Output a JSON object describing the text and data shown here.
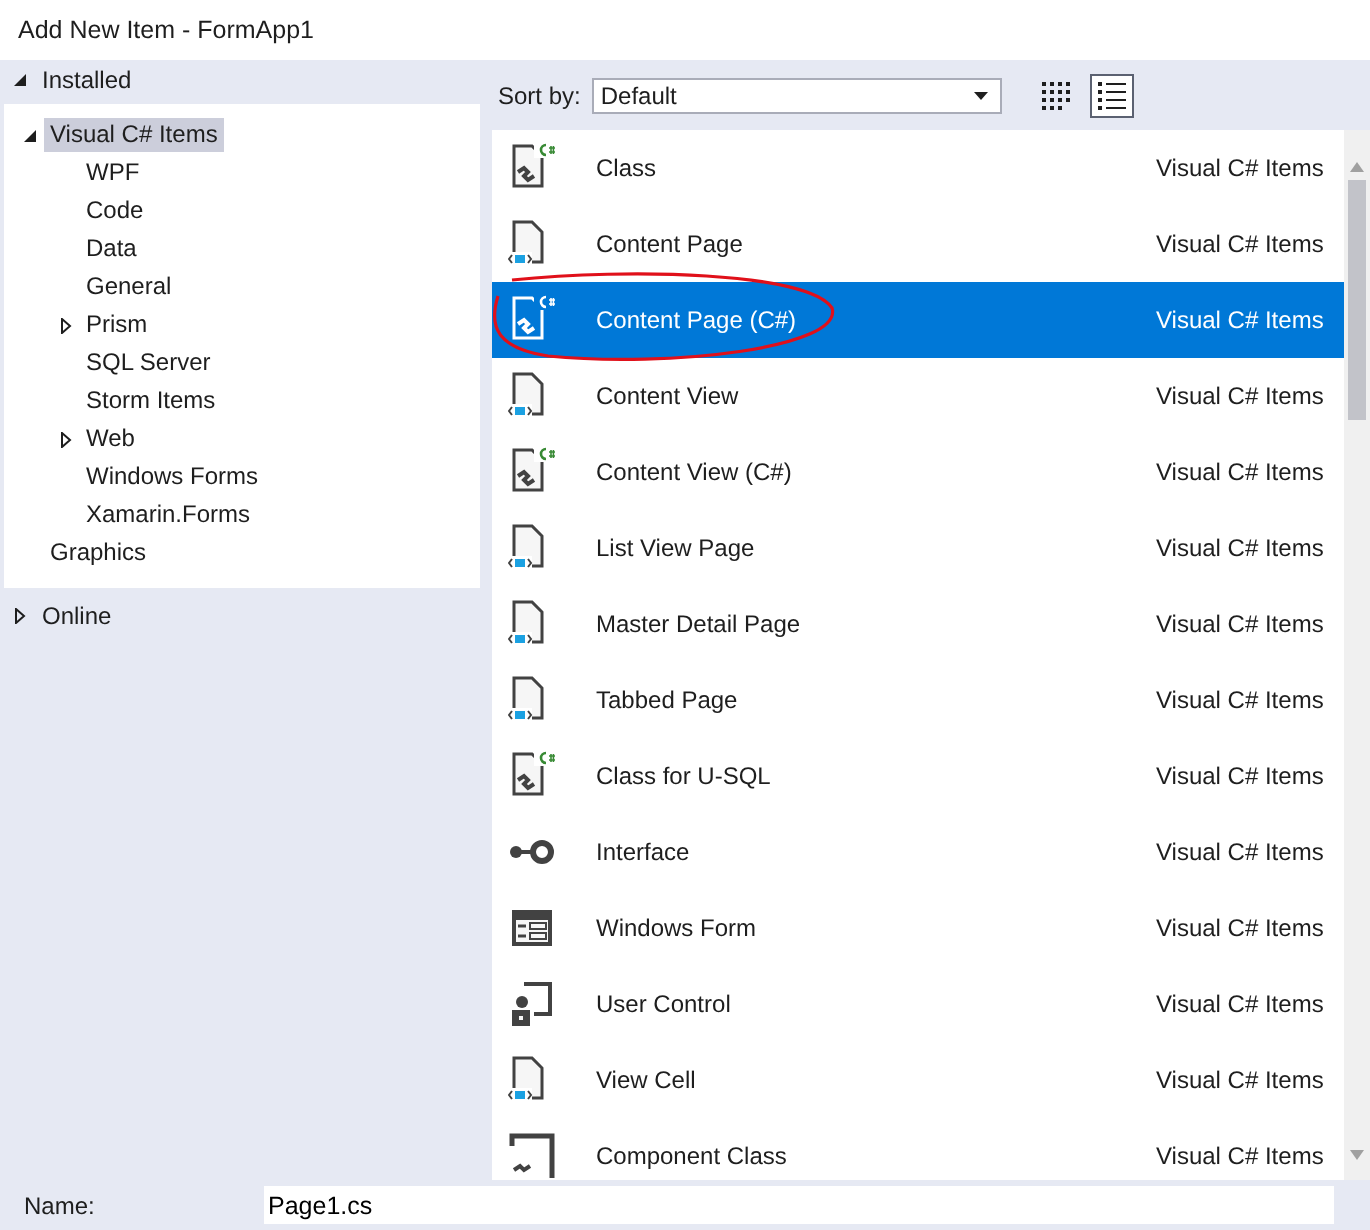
{
  "window": {
    "title": "Add New Item - FormApp1"
  },
  "tree": [
    {
      "label": "Installed",
      "expanded": true,
      "children": [
        {
          "label": "Visual C# Items",
          "expanded": true,
          "selected": true,
          "children": [
            {
              "label": "WPF",
              "selected": false
            },
            {
              "label": "Code",
              "selected": false
            },
            {
              "label": "Data",
              "selected": false
            },
            {
              "label": "General",
              "selected": false
            },
            {
              "label": "Prism",
              "expanded": false,
              "selected": false
            },
            {
              "label": "SQL Server",
              "selected": false
            },
            {
              "label": "Storm Items",
              "selected": false
            },
            {
              "label": "Web",
              "expanded": false,
              "selected": false
            },
            {
              "label": "Windows Forms",
              "selected": false
            },
            {
              "label": "Xamarin.Forms",
              "selected": false
            }
          ]
        },
        {
          "label": "Graphics",
          "selected": false
        }
      ]
    },
    {
      "label": "Online",
      "expanded": false
    }
  ],
  "toolbar": {
    "sort_label": "Sort by:",
    "sort_value": "Default",
    "views": [
      {
        "kind": "grid",
        "selected": false
      },
      {
        "kind": "list",
        "selected": true
      }
    ]
  },
  "items": [
    {
      "name": "Class",
      "category": "Visual C# Items",
      "kind": "cs",
      "selected": false,
      "circled": false
    },
    {
      "name": "Content Page",
      "category": "Visual C# Items",
      "kind": "xaml",
      "selected": false,
      "circled": false
    },
    {
      "name": "Content Page (C#)",
      "category": "Visual C# Items",
      "kind": "cs",
      "selected": true,
      "circled": true
    },
    {
      "name": "Content View",
      "category": "Visual C# Items",
      "kind": "xaml",
      "selected": false,
      "circled": false
    },
    {
      "name": "Content View (C#)",
      "category": "Visual C# Items",
      "kind": "cs",
      "selected": false,
      "circled": false
    },
    {
      "name": "List View Page",
      "category": "Visual C# Items",
      "kind": "xaml",
      "selected": false,
      "circled": false
    },
    {
      "name": "Master Detail Page",
      "category": "Visual C# Items",
      "kind": "xaml",
      "selected": false,
      "circled": false
    },
    {
      "name": "Tabbed Page",
      "category": "Visual C# Items",
      "kind": "xaml",
      "selected": false,
      "circled": false
    },
    {
      "name": "Class for U-SQL",
      "category": "Visual C# Items",
      "kind": "cs",
      "selected": false,
      "circled": false
    },
    {
      "name": "Interface",
      "category": "Visual C# Items",
      "kind": "interface",
      "selected": false,
      "circled": false
    },
    {
      "name": "Windows Form",
      "category": "Visual C# Items",
      "kind": "form",
      "selected": false,
      "circled": false
    },
    {
      "name": "User Control",
      "category": "Visual C# Items",
      "kind": "usercontrol",
      "selected": false,
      "circled": false
    },
    {
      "name": "View Cell",
      "category": "Visual C# Items",
      "kind": "xaml",
      "selected": false,
      "circled": false
    },
    {
      "name": "Component Class",
      "category": "Visual C# Items",
      "kind": "component",
      "selected": false,
      "circled": false
    }
  ],
  "name_field": {
    "label": "Name:",
    "value": "Page1.cs"
  }
}
